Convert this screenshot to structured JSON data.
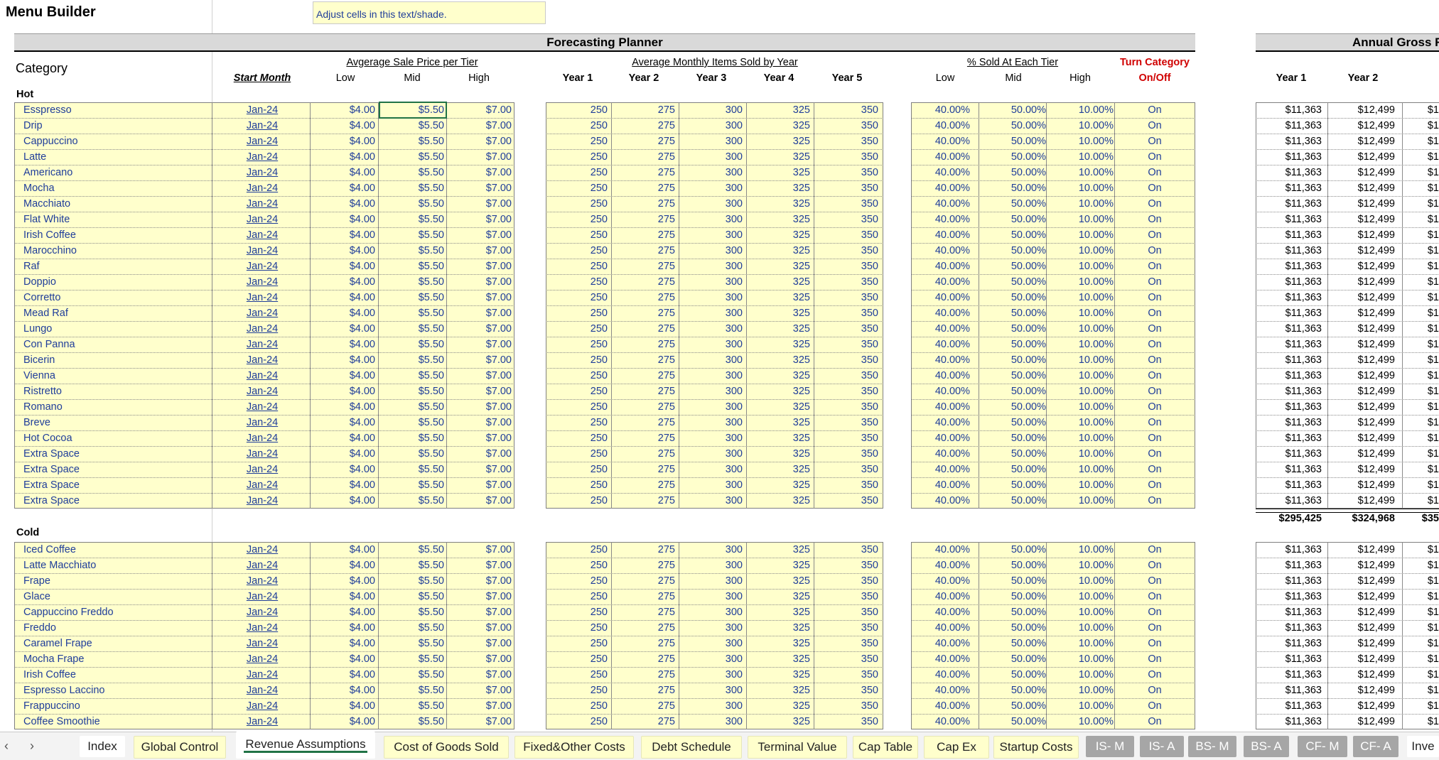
{
  "sheet": {
    "title": "Menu Builder",
    "note": "Adjust cells in this text/shade.",
    "band_forecast": "Forecasting Planner",
    "band_annual": "Annual Gross R",
    "category_label": "Category"
  },
  "headers": {
    "start_month": "Start Month",
    "price_group": "Avgerage Sale Price per Tier",
    "units_group": "Average Monthly Items Sold by Year",
    "pct_group": "% Sold At Each Tier",
    "turn_line1": "Turn Category",
    "turn_line2": "On/Off",
    "tiers": [
      "Low",
      "Mid",
      "High"
    ],
    "years": [
      "Year 1",
      "Year 2",
      "Year 3",
      "Year 4",
      "Year 5"
    ],
    "annual_years": [
      "Year 1",
      "Year 2"
    ]
  },
  "defaults": {
    "start": "Jan-24",
    "prices": [
      "$4.00",
      "$5.50",
      "$7.00"
    ],
    "units": [
      "250",
      "275",
      "300",
      "325",
      "350"
    ],
    "pcts": [
      "40.00%",
      "50.00%",
      "10.00%"
    ],
    "onoff": "On",
    "annual": [
      "$11,363",
      "$12,499",
      "$1"
    ]
  },
  "sections": [
    {
      "name": "Hot",
      "items": [
        "Esspresso",
        "Drip",
        "Cappuccino",
        "Latte",
        "Americano",
        "Mocha",
        "Macchiato",
        "Flat White",
        "Irish Coffee",
        "Marocchino",
        "Raf",
        "Doppio",
        "Corretto",
        "Mead Raf",
        "Lungo",
        "Con Panna",
        "Bicerin",
        "Vienna",
        "Ristretto",
        "Romano",
        "Breve",
        "Hot Cocoa",
        "Extra Space",
        "Extra Space",
        "Extra Space",
        "Extra Space"
      ],
      "totals": [
        "$295,425",
        "$324,968",
        "$35"
      ]
    },
    {
      "name": "Cold",
      "items": [
        "Iced Coffee",
        "Latte Macchiato",
        "Frape",
        "Glace",
        "Cappuccino Freddo",
        "Freddo",
        "Caramel Frape",
        "Mocha Frape",
        "Irish Coffee",
        "Espresso Laccino",
        "Frappuccino",
        "Coffee Smoothie"
      ]
    }
  ],
  "tabs": [
    {
      "label": "Index",
      "style": "norm"
    },
    {
      "label": "Global Control",
      "style": "yel"
    },
    {
      "label": "Revenue Assumptions",
      "style": "act"
    },
    {
      "label": "Cost of Goods Sold",
      "style": "yel"
    },
    {
      "label": "Fixed&Other Costs",
      "style": "yel"
    },
    {
      "label": "Debt Schedule",
      "style": "yel"
    },
    {
      "label": "Terminal Value",
      "style": "yel"
    },
    {
      "label": "Cap Table",
      "style": "yel"
    },
    {
      "label": "Cap Ex",
      "style": "yel"
    },
    {
      "label": "Startup Costs",
      "style": "yel"
    },
    {
      "label": "IS- M",
      "style": "gry"
    },
    {
      "label": "IS- A",
      "style": "gry"
    },
    {
      "label": "BS- M",
      "style": "gry"
    },
    {
      "label": "BS- A",
      "style": "gry"
    },
    {
      "label": "CF- M",
      "style": "gry"
    },
    {
      "label": "CF- A",
      "style": "gry"
    },
    {
      "label": "Inve",
      "style": "norm"
    }
  ],
  "nav": {
    "prev": "‹",
    "next": "›"
  }
}
